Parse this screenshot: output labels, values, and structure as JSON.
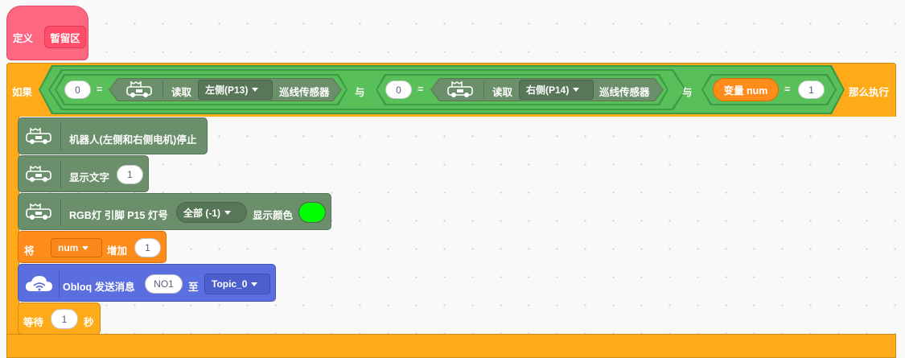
{
  "define_block": {
    "define_label": "定义",
    "procedure_name": "暂留区"
  },
  "if_block": {
    "if_label": "如果",
    "then_label": "那么执行",
    "and_labels": [
      "与",
      "与"
    ],
    "cond1": {
      "value": "0",
      "eq": "=",
      "read_label": "读取",
      "sensor_option": "左侧(P13)",
      "sensor_name": "巡线传感器"
    },
    "cond2": {
      "value": "0",
      "eq": "=",
      "read_label": "读取",
      "sensor_option": "右侧(P14)",
      "sensor_name": "巡线传感器"
    },
    "cond3": {
      "variable": "变量 num",
      "eq": "=",
      "value": "1"
    }
  },
  "stack": {
    "robot_stop": "机器人(左侧和右侧电机)停止",
    "show_text": {
      "label": "显示文字",
      "value": "1"
    },
    "rgb": {
      "label": "RGB灯 引脚 P15 灯号",
      "option": "全部 (-1)",
      "show_color_label": "显示颜色",
      "color": "#00ff00"
    },
    "change_var": {
      "label_prefix": "将",
      "var_option": "num",
      "label_suffix": "增加",
      "value": "1"
    },
    "obloq": {
      "label": "Obloq 发送消息",
      "message": "NO1",
      "to_label": "至",
      "topic_option": "Topic_0"
    },
    "wait": {
      "label": "等待",
      "value": "1",
      "unit": "秒"
    }
  },
  "icons": {
    "robot": "robot-car-icon",
    "wifi": "wifi-cloud-icon",
    "dropdown": "chevron-down-icon"
  }
}
